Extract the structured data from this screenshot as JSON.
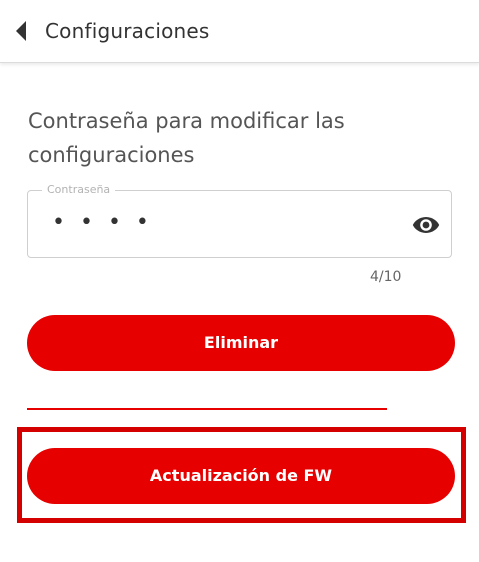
{
  "header": {
    "back_icon": "chevron-left-icon",
    "title": "Configuraciones"
  },
  "section": {
    "title": "Contraseña para modificar las configuraciones"
  },
  "password": {
    "label": "Contraseña",
    "masked_value": "••••",
    "visibility_icon": "eye-icon",
    "counter": "4/10"
  },
  "buttons": {
    "delete_label": "Eliminar",
    "update_fw_label": "Actualización de FW"
  },
  "colors": {
    "accent": "#e60000",
    "highlight_border": "#d40000",
    "text": "#333333",
    "border": "#cfcfcf"
  }
}
